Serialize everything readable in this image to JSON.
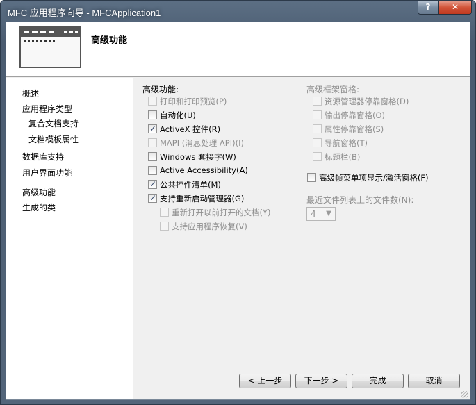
{
  "window": {
    "title": "MFC 应用程序向导 - MFCApplication1",
    "help_label": "?",
    "close_label": "✕"
  },
  "header": {
    "title": "高级功能"
  },
  "nav": {
    "items": [
      {
        "label": "概述"
      },
      {
        "label": "应用程序类型"
      },
      {
        "label": "复合文档支持"
      },
      {
        "label": "文档模板属性"
      },
      {
        "label": "数据库支持"
      },
      {
        "label": "用户界面功能"
      },
      {
        "label": "高级功能"
      },
      {
        "label": "生成的类"
      }
    ]
  },
  "left_group": {
    "heading": "高级功能:",
    "options": [
      {
        "label": "打印和打印预览(P)",
        "checked": false,
        "enabled": false
      },
      {
        "label": "自动化(U)",
        "checked": false,
        "enabled": true
      },
      {
        "label": "ActiveX 控件(R)",
        "checked": true,
        "enabled": true
      },
      {
        "label": "MAPI (消息处理 API)(I)",
        "checked": false,
        "enabled": false
      },
      {
        "label": "Windows 套接字(W)",
        "checked": false,
        "enabled": true
      },
      {
        "label": "Active Accessibility(A)",
        "checked": false,
        "enabled": true
      },
      {
        "label": "公共控件清单(M)",
        "checked": true,
        "enabled": true
      },
      {
        "label": "支持重新启动管理器(G)",
        "checked": true,
        "enabled": true
      },
      {
        "label": "重新打开以前打开的文档(Y)",
        "checked": false,
        "enabled": false
      },
      {
        "label": "支持应用程序恢复(V)",
        "checked": false,
        "enabled": false
      }
    ]
  },
  "right_group": {
    "heading": "高级框架窗格:",
    "options": [
      {
        "label": "资源管理器停靠窗格(D)",
        "checked": false,
        "enabled": false
      },
      {
        "label": "输出停靠窗格(O)",
        "checked": false,
        "enabled": false
      },
      {
        "label": "属性停靠窗格(S)",
        "checked": false,
        "enabled": false
      },
      {
        "label": "导航窗格(T)",
        "checked": false,
        "enabled": false
      },
      {
        "label": "标题栏(B)",
        "checked": false,
        "enabled": false
      }
    ],
    "frame_menu_option": {
      "label": "高级帧菜单项显示/激活窗格(F)",
      "checked": false,
      "enabled": true
    },
    "mru_label": "最近文件列表上的文件数(N):",
    "mru_value": "4"
  },
  "buttons": {
    "prev": "< 上一步",
    "next": "下一步 >",
    "finish": "完成",
    "cancel": "取消"
  },
  "colors": {
    "title_bar": "#4a5b70",
    "close": "#c0391f",
    "panel": "#f0f0f0",
    "disabled_text": "#8e8e8e"
  }
}
